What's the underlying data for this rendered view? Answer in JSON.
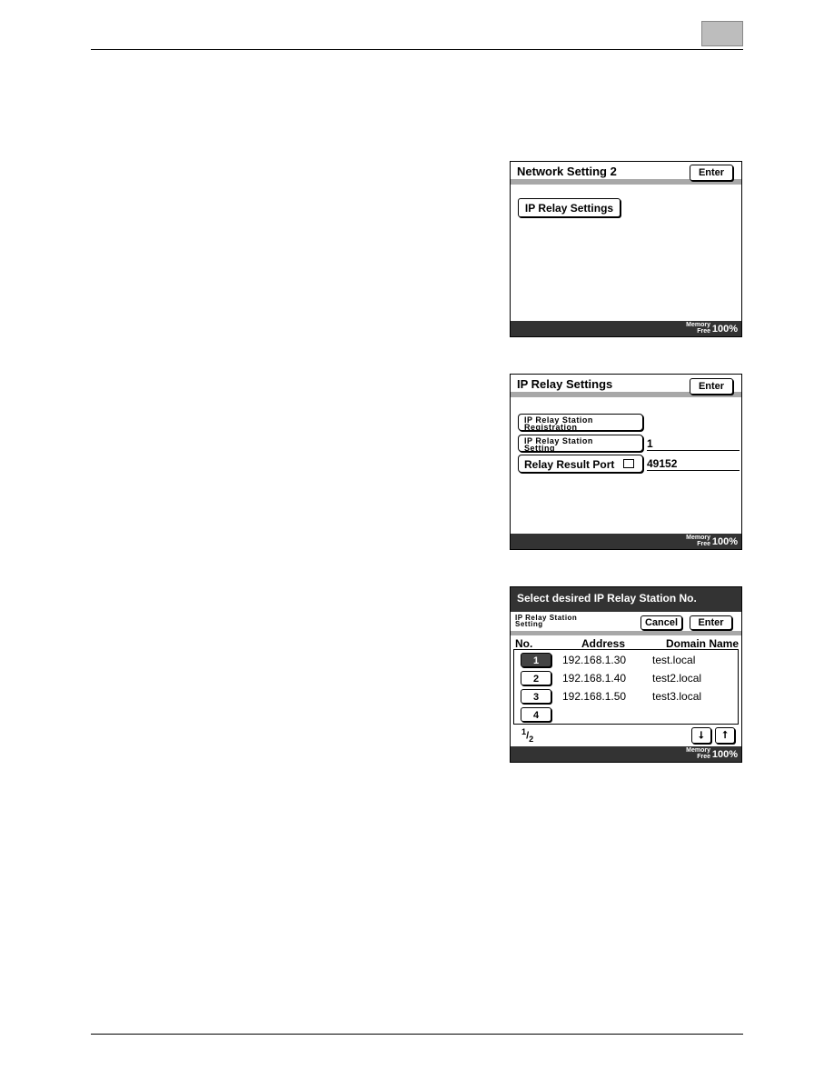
{
  "panel1": {
    "title": "Network Setting  2",
    "enter": "Enter",
    "button": "IP Relay Settings",
    "memory": "Memory",
    "free": "Free",
    "percent": "100%"
  },
  "panel2": {
    "title": "IP Relay Settings",
    "enter": "Enter",
    "registration_line1": "IP Relay Station",
    "registration_line2": "Registration",
    "setting_line1": "IP Relay Station",
    "setting_line2": "Setting",
    "setting_value": "1",
    "port_label": "Relay Result Port",
    "port_value": "49152",
    "memory": "Memory",
    "free": "Free",
    "percent": "100%"
  },
  "panel3": {
    "title": "Select desired IP Relay Station No.",
    "sub_line1": "IP Relay Station",
    "sub_line2": "Setting",
    "cancel": "Cancel",
    "enter": "Enter",
    "columns": [
      "No.",
      "Address",
      "Domain Name"
    ],
    "rows": [
      {
        "no": "1",
        "address": "192.168.1.30",
        "domain": "test.local"
      },
      {
        "no": "2",
        "address": "192.168.1.40",
        "domain": "test2.local"
      },
      {
        "no": "3",
        "address": "192.168.1.50",
        "domain": "test3.local"
      },
      {
        "no": "4",
        "address": "",
        "domain": ""
      }
    ],
    "page_num": "1",
    "page_den": "2",
    "memory": "Memory",
    "free": "Free",
    "percent": "100%"
  }
}
